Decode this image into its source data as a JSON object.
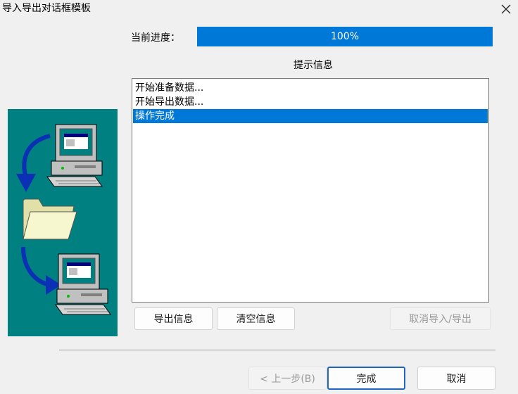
{
  "window": {
    "title": "导入导出对话框模板",
    "close_icon": "close-icon"
  },
  "progress": {
    "label": "当前进度：",
    "value_text": "100%",
    "value": 1.0,
    "color": "#0078d7"
  },
  "messages": {
    "heading": "提示信息",
    "items": [
      "开始准备数据...",
      "开始导出数据...",
      "操作完成"
    ],
    "selected_index": 2
  },
  "action_buttons": {
    "export_info": "导出信息",
    "clear_info": "清空信息",
    "cancel_import_export": "取消导入/导出"
  },
  "footer": {
    "back": "< 上一步(B)",
    "finish": "完成",
    "cancel": "取消"
  },
  "illustration": {
    "background_color": "#008080",
    "icons": [
      "computer-icon",
      "arrow-icon",
      "folder-icon",
      "arrow-icon",
      "computer-icon"
    ]
  }
}
